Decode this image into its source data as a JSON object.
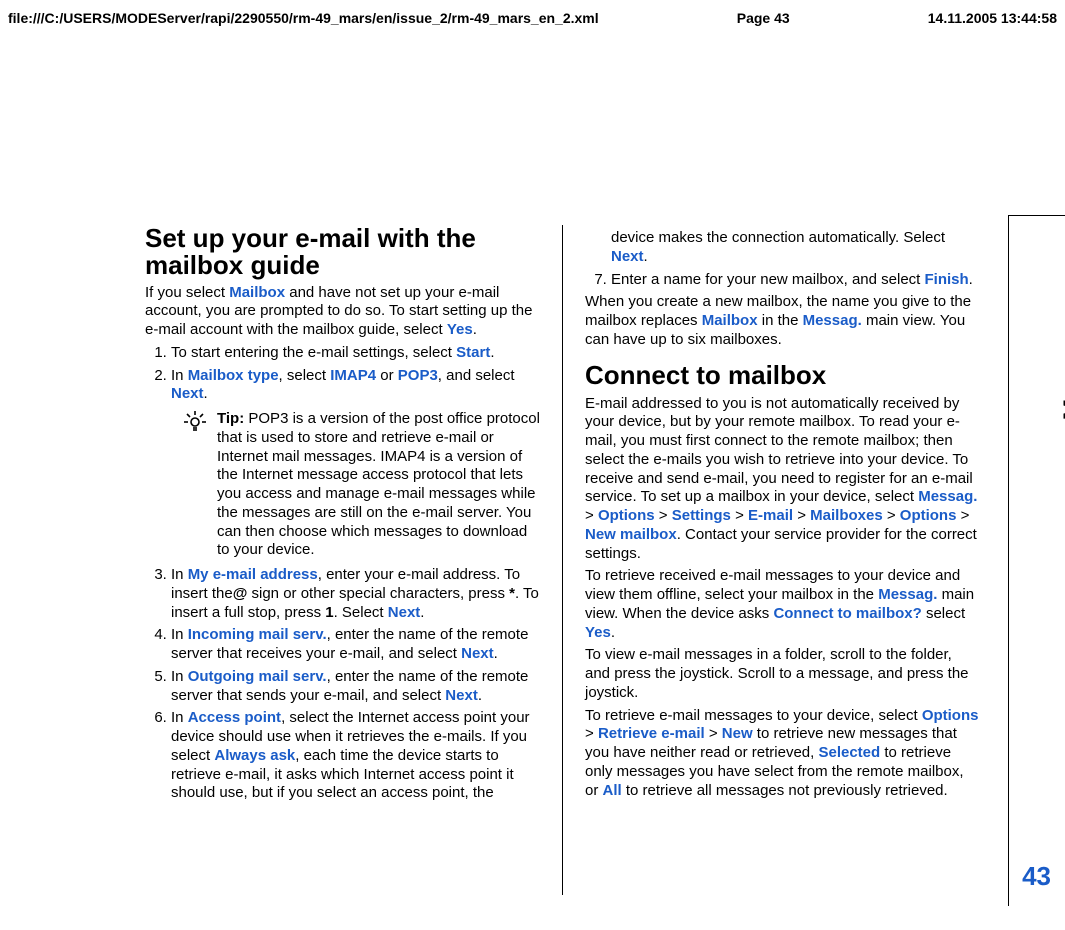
{
  "header": {
    "path": "file:///C:/USERS/MODEServer/rapi/2290550/rm-49_mars/en/issue_2/rm-49_mars_en_2.xml",
    "page": "Page 43",
    "date": "14.11.2005 13:44:58"
  },
  "side": {
    "label": "Messages",
    "num": "43"
  },
  "left": {
    "h1": "Set up your e-mail with the mailbox guide",
    "intro": {
      "a": "If you select ",
      "b": "Mailbox",
      "c": " and have not set up your e-mail account, you are prompted to do so. To start setting up the e-mail account with the mailbox guide, select ",
      "d": "Yes",
      "e": "."
    },
    "s1": {
      "a": "To start entering the e-mail settings, select ",
      "b": "Start",
      "c": "."
    },
    "s2": {
      "a": "In ",
      "b": "Mailbox type",
      "c": ", select ",
      "d": "IMAP4",
      "e": " or ",
      "f": "POP3",
      "g": ", and select ",
      "h": "Next",
      "i": "."
    },
    "tip": {
      "label": "Tip:",
      "text": " POP3 is a version of the post office protocol that is used to store and retrieve e-mail or Internet mail messages. IMAP4 is a version of the Internet message access protocol that lets you access and manage e-mail messages while the messages are still on the e-mail server. You can then choose which messages to download to your device."
    },
    "s3": {
      "a": "In ",
      "b": "My e-mail address",
      "c": ", enter your e-mail address. To insert the",
      "d": "@",
      "e": " sign or other special characters, press ",
      "f": "*",
      "g": ". To insert a full stop, press ",
      "h": "1",
      "i": ". Select ",
      "j": "Next",
      "k": "."
    },
    "s4": {
      "a": "In ",
      "b": "Incoming mail serv.",
      "c": ", enter the name of the remote server that receives your e-mail, and select ",
      "d": "Next",
      "e": "."
    },
    "s5": {
      "a": "In ",
      "b": "Outgoing mail serv.",
      "c": ", enter the name of the remote server that sends your e-mail, and select ",
      "d": "Next",
      "e": "."
    },
    "s6": {
      "a": "In ",
      "b": "Access point",
      "c": ", select the Internet access point your device should use when it retrieves the e-mails. If you select ",
      "d": "Always ask",
      "e": ", each time the device starts to retrieve e-mail, it asks which Internet access point it should use, but if you select an access point, the"
    }
  },
  "right": {
    "s6b": {
      "a": "device makes the connection automatically. Select ",
      "b": "Next",
      "c": "."
    },
    "s7": {
      "a": "Enter a name for your new mailbox, and select ",
      "b": "Finish",
      "c": "."
    },
    "after": {
      "a": "When you create a new mailbox, the name you give to the mailbox replaces ",
      "b": "Mailbox",
      "c": " in the ",
      "d": "Messag.",
      "e": " main view. You can have up to six mailboxes."
    },
    "h2": "Connect to mailbox",
    "p1": {
      "a": "E-mail addressed to you is not automatically received by your device, but by your remote mailbox. To read your e-mail, you must first connect to the remote mailbox; then select the e-mails you wish to retrieve into your device. To receive and send e-mail, you need to register for an e-mail service. To set up a mailbox in your device, select ",
      "b": "Messag.",
      "c": " > ",
      "d": "Options",
      "e": " > ",
      "f": "Settings",
      "g": " > ",
      "h": "E-mail",
      "i": " > ",
      "j": "Mailboxes",
      "k": " > ",
      "l": "Options",
      "m": " > ",
      "n": "New mailbox",
      "o": ". Contact your service provider for the correct settings."
    },
    "p2": {
      "a": "To retrieve received e-mail messages to your device and view them offline, select your mailbox in the ",
      "b": "Messag.",
      "c": " main view. When the device asks ",
      "d": "Connect to mailbox?",
      "e": " select ",
      "f": "Yes",
      "g": "."
    },
    "p3": "To view e-mail messages in a folder, scroll to the folder, and press the joystick. Scroll to a message, and press the joystick.",
    "p4": {
      "a": "To retrieve e-mail messages to your device, select ",
      "b": "Options",
      "c": " > ",
      "d": "Retrieve e-mail",
      "e": " > ",
      "f": "New",
      "g": " to retrieve new messages that you have neither read or retrieved, ",
      "h": "Selected",
      "i": " to retrieve only messages you have select from the remote mailbox, or ",
      "j": "All",
      "k": " to retrieve all messages not previously retrieved."
    }
  }
}
